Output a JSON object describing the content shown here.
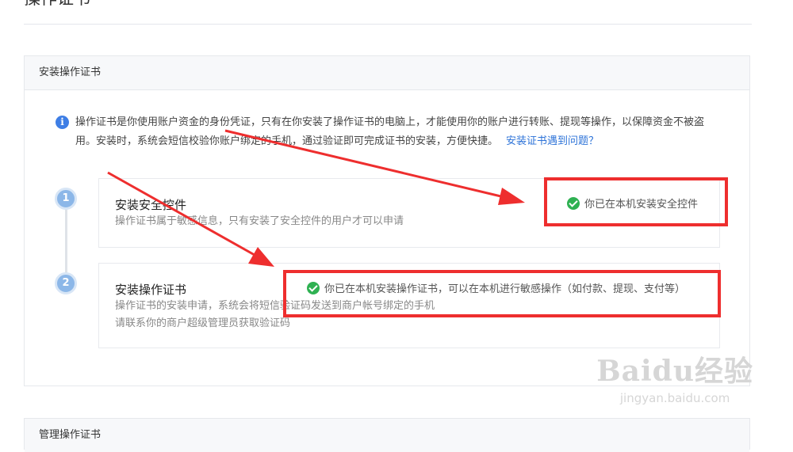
{
  "page": {
    "title": "操作证书"
  },
  "install_section": {
    "header": "安装操作证书",
    "info": {
      "text": "操作证书是你使用账户资金的身份凭证，只有在你安装了操作证书的电脑上，才能使用你的账户进行转账、提现等操作，以保障资金不被盗用。安装时，系统会短信校验你账户绑定的手机，通过验证即可完成证书的安装，方便快捷。",
      "link": "安装证书遇到问题？"
    },
    "steps": [
      {
        "number": "1",
        "title": "安装安全控件",
        "desc": "操作证书属于敏感信息，只有安装了安全控件的用户才可以申请",
        "status": "你已在本机安装安全控件"
      },
      {
        "number": "2",
        "title": "安装操作证书",
        "desc_line1": "操作证书的安装申请，系统会将短信验证码发送到商户帐号绑定的手机",
        "desc_line2": "请联系你的商户超级管理员获取验证码",
        "status": "你已在本机安装操作证书，可以在本机进行敏感操作（如付款、提现、支付等）"
      }
    ]
  },
  "manage_section": {
    "header": "管理操作证书"
  },
  "watermark": {
    "logo": "Baidu经验",
    "url": "jingyan.baidu.com"
  },
  "colors": {
    "highlight": "#ee2e2e",
    "success": "#2fb152",
    "link": "#2d73d8"
  }
}
